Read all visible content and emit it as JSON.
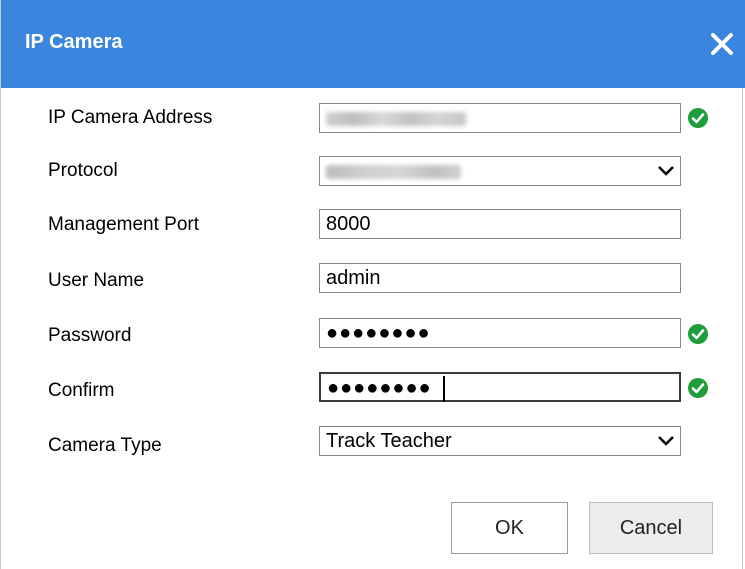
{
  "dialog": {
    "title": "IP Camera",
    "close_icon": "close-icon",
    "accent_color": "#3a85dd"
  },
  "form": {
    "ip_address": {
      "label": "IP Camera Address",
      "value": "",
      "valid": true
    },
    "protocol": {
      "label": "Protocol",
      "value": ""
    },
    "management_port": {
      "label": "Management Port",
      "value": "8000"
    },
    "user_name": {
      "label": "User Name",
      "value": "admin"
    },
    "password": {
      "label": "Password",
      "value": "●●●●●●●●",
      "valid": true
    },
    "confirm": {
      "label": "Confirm",
      "value": "●●●●●●●●",
      "valid": true
    },
    "camera_type": {
      "label": "Camera Type",
      "value": "Track Teacher"
    }
  },
  "buttons": {
    "ok": "OK",
    "cancel": "Cancel"
  },
  "status_colors": {
    "valid": "#1e9e3a"
  }
}
